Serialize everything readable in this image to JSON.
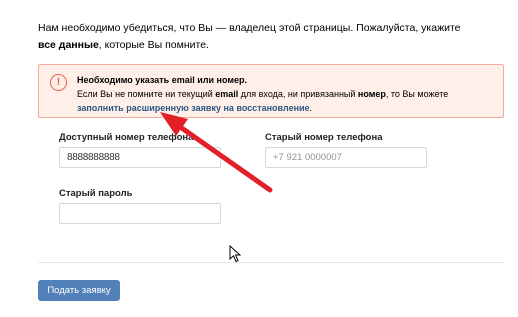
{
  "intro": {
    "text1": "Нам необходимо убедиться, что Вы — владелец этой страницы. Пожалуйста, укажите ",
    "bold": "все данные",
    "text2": ", которые Вы помните."
  },
  "alert": {
    "title": "Необходимо указать email или номер.",
    "line_a": "Если Вы не помните ни текущий ",
    "bold_email": "email",
    "line_b": " для входа, ни привязанный ",
    "bold_number": "номер",
    "line_c": ", то Вы можете",
    "link": "заполнить расширенную заявку на восстановление",
    "link_tail": "."
  },
  "form": {
    "available_phone_label": "Доступный номер телефона",
    "available_phone_value": "8888888888",
    "old_phone_label": "Старый номер телефона",
    "old_phone_placeholder": "+7 921 0000007",
    "old_password_label": "Старый пароль",
    "old_password_value": ""
  },
  "submit_label": "Подать заявку",
  "colors": {
    "accent": "#5181b8",
    "link": "#2a5885",
    "alert_bg": "#ffefe9",
    "alert_border": "#f2ab99",
    "annotation_arrow": "#e3202a"
  },
  "icons": {
    "alert": "exclamation-circle-icon",
    "cursor": "mouse-pointer-icon",
    "annotation": "red-arrow-annotation"
  }
}
